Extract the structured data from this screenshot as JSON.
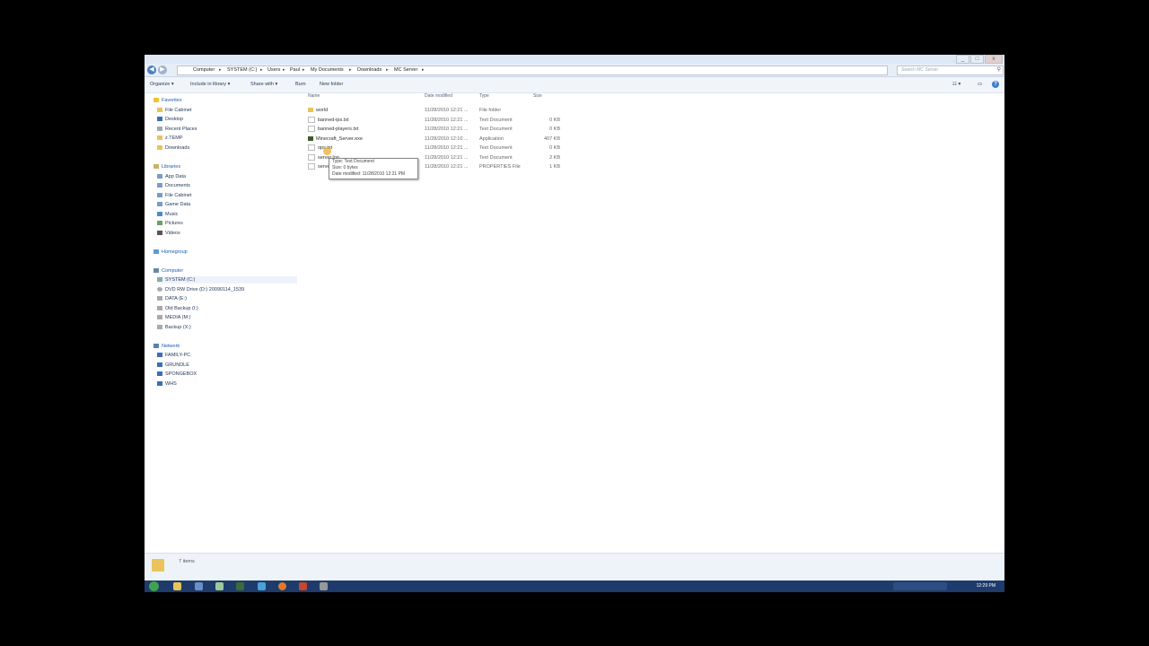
{
  "window": {
    "controls": [
      "_",
      "□",
      "x"
    ]
  },
  "nav": {
    "back": "◀",
    "forward": "▶",
    "breadcrumbs": [
      "Computer",
      "SYSTEM (C:)",
      "Users",
      "Paul",
      "My Documents",
      "Downloads",
      "MC Server"
    ],
    "search_placeholder": "Search MC Server"
  },
  "toolbar": {
    "organize": "Organize ▾",
    "include": "Include in library ▾",
    "share": "Share with ▾",
    "burn": "Burn",
    "new_folder": "New folder",
    "help": "?"
  },
  "sidebar": {
    "favorites": {
      "label": "Favorites",
      "items": [
        "File Cabinet",
        "Desktop",
        "Recent Places",
        "z.TEMP",
        "Downloads"
      ]
    },
    "libraries": {
      "label": "Libraries",
      "items": [
        "App Data",
        "Documents",
        "File Cabinet",
        "Game Data",
        "Music",
        "Pictures",
        "Videos"
      ]
    },
    "homegroup": {
      "label": "Homegroup"
    },
    "computer": {
      "label": "Computer",
      "items": [
        "SYSTEM (C:)",
        "DVD RW Drive (D:) 20090114_1539",
        "DATA (E:)",
        "Old Backup (I:)",
        "MEDIA (M:)",
        "Backup (X:)"
      ]
    },
    "network": {
      "label": "Network",
      "items": [
        "FAMILY-PC",
        "GRUNDLE",
        "SPONGEBOX",
        "WHS"
      ]
    }
  },
  "columns": {
    "name": "Name",
    "date": "Date modified",
    "type": "Type",
    "size": "Size"
  },
  "files": [
    {
      "name": "world",
      "date": "11/28/2010 12:21 ...",
      "type": "File folder",
      "size": "",
      "icon": "folder"
    },
    {
      "name": "banned-ips.txt",
      "date": "11/28/2010 12:21 ...",
      "type": "Text Document",
      "size": "0 KB",
      "icon": "text"
    },
    {
      "name": "banned-players.txt",
      "date": "11/28/2010 12:21 ...",
      "type": "Text Document",
      "size": "0 KB",
      "icon": "text"
    },
    {
      "name": "Minecraft_Server.exe",
      "date": "11/28/2010 12:10 ...",
      "type": "Application",
      "size": "407 KB",
      "icon": "app"
    },
    {
      "name": "ops.txt",
      "date": "11/28/2010 12:21 ...",
      "type": "Text Document",
      "size": "0 KB",
      "icon": "text"
    },
    {
      "name": "server.log",
      "date": "11/28/2010 12:21 ...",
      "type": "Text Document",
      "size": "2 KB",
      "icon": "text"
    },
    {
      "name": "server.properties",
      "date": "11/28/2010 12:21 ...",
      "type": "PROPERTIES File",
      "size": "1 KB",
      "icon": "text"
    }
  ],
  "tooltip": {
    "type": "Type: Text Document",
    "size": "Size: 0 bytes",
    "date": "Date modified: 11/28/2010 12:21 PM"
  },
  "status": {
    "count": "7 items"
  },
  "taskbar": {
    "clock": "12:29 PM"
  },
  "colors": {
    "folder": "#e8c45a",
    "accent": "#3d7dd0",
    "taskbar": "#1f3b6b"
  }
}
